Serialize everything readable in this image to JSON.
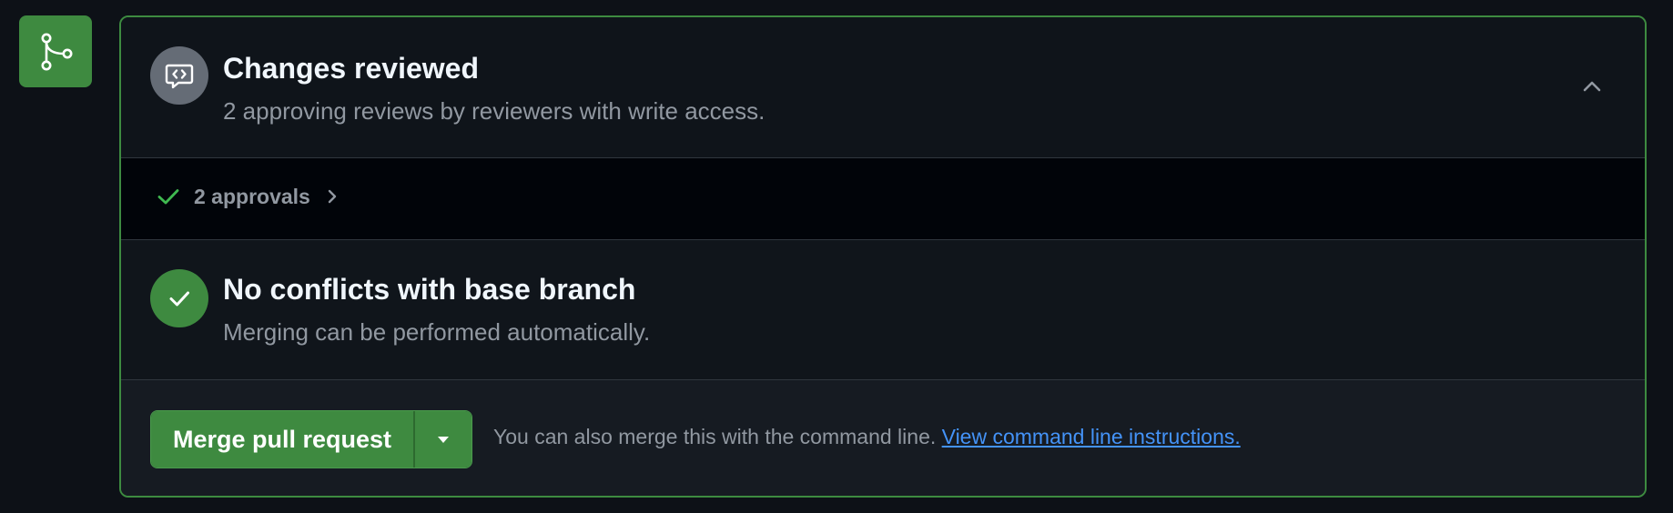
{
  "timeline": {
    "icon": "git-merge-icon",
    "icon_bg": "#3e8a40"
  },
  "reviews": {
    "icon": "code-review-icon",
    "title": "Changes reviewed",
    "subtitle": "2 approving reviews by reviewers with write access.",
    "collapse_icon": "chevron-up-icon"
  },
  "approvals": {
    "icon": "check-icon",
    "label": "2 approvals",
    "expand_icon": "chevron-right-icon"
  },
  "conflicts": {
    "icon": "check-circle-icon",
    "title": "No conflicts with base branch",
    "subtitle": "Merging can be performed automatically."
  },
  "merge": {
    "button_label": "Merge pull request",
    "dropdown_icon": "triangle-down-icon",
    "hint": "You can also merge this with the command line.",
    "link": "View command line instructions."
  },
  "colors": {
    "accent_green": "#3e8a40",
    "link_blue": "#4493f8",
    "muted_text": "#9198a1",
    "border_green": "#3d8b40"
  }
}
